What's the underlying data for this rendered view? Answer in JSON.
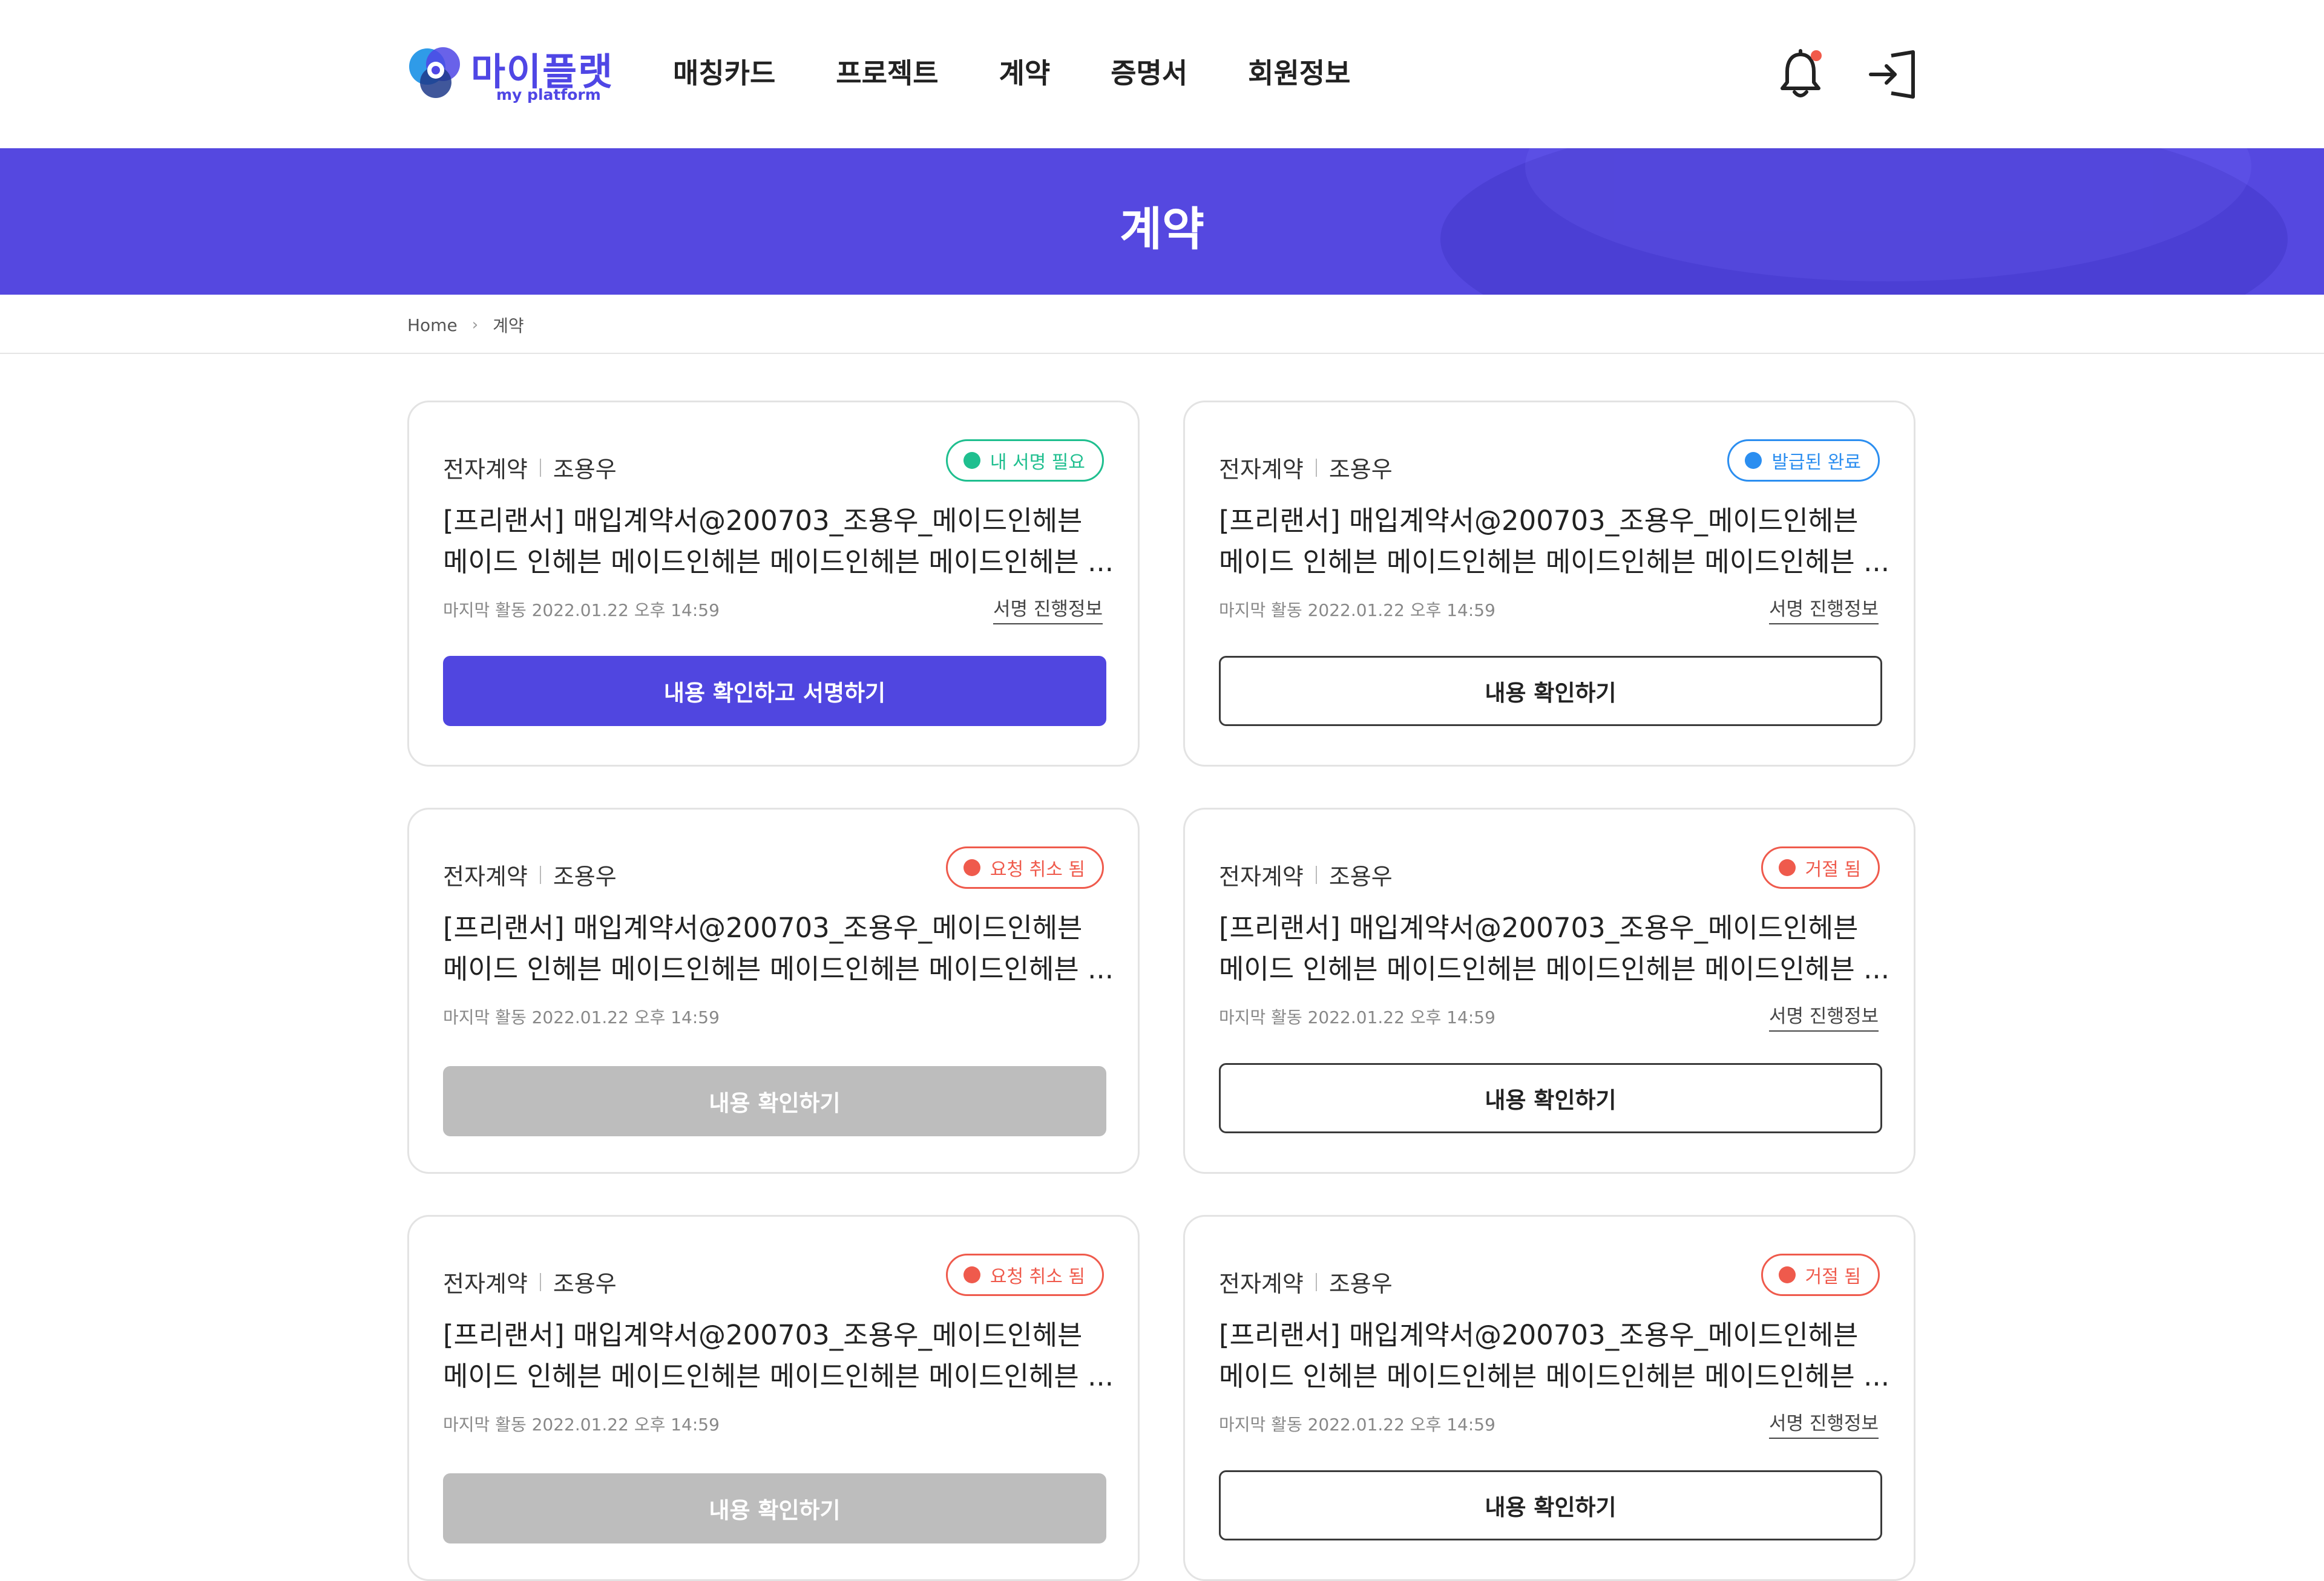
{
  "brand": {
    "name": "마이플랫",
    "sub": "my platform",
    "color": "#4f46e5"
  },
  "nav": {
    "items": [
      {
        "label": "매칭카드"
      },
      {
        "label": "프로젝트"
      },
      {
        "label": "계약"
      },
      {
        "label": "증명서"
      },
      {
        "label": "회원정보"
      }
    ],
    "bell_icon": "bell-icon",
    "logout_icon": "logout-icon",
    "notification_dot_color": "#f15a4a"
  },
  "banner": {
    "title": "계약",
    "color": "#5548e0"
  },
  "breadcrumb": {
    "home": "Home",
    "current": "계약"
  },
  "cards": [
    {
      "type": "전자계약",
      "name": "조용우",
      "status": "내 서명 필요",
      "status_color": "#1fbf8f",
      "title": "[프리랜서] 매입계약서@200703_조용우_메이드인헤븐 메이드 인헤븐 메이드인헤븐 메이드인헤븐 메이드인헤븐 ...",
      "meta": "마지막 활동 2022.01.22 오후 14:59",
      "link": "서명 진행정보",
      "button": "내용 확인하고 서명하기",
      "button_style": "primary"
    },
    {
      "type": "전자계약",
      "name": "조용우",
      "status": "발급된 완료",
      "status_color": "#2b8ef0",
      "title": "[프리랜서] 매입계약서@200703_조용우_메이드인헤븐 메이드 인헤븐 메이드인헤븐 메이드인헤븐 메이드인헤븐 ...",
      "meta": "마지막 활동 2022.01.22 오후 14:59",
      "link": "서명 진행정보",
      "button": "내용 확인하기",
      "button_style": "outline"
    },
    {
      "type": "전자계약",
      "name": "조용우",
      "status": "요청 취소 됨",
      "status_color": "#ef5a4c",
      "title": "[프리랜서] 매입계약서@200703_조용우_메이드인헤븐 메이드 인헤븐 메이드인헤븐 메이드인헤븐 메이드인헤븐 ...",
      "meta": "마지막 활동 2022.01.22 오후 14:59",
      "link": "",
      "button": "내용 확인하기",
      "button_style": "disabled"
    },
    {
      "type": "전자계약",
      "name": "조용우",
      "status": "거절 됨",
      "status_color": "#ef5a4c",
      "title": "[프리랜서] 매입계약서@200703_조용우_메이드인헤븐 메이드 인헤븐 메이드인헤븐 메이드인헤븐 메이드인헤븐 ...",
      "meta": "마지막 활동 2022.01.22 오후 14:59",
      "link": "서명 진행정보",
      "button": "내용 확인하기",
      "button_style": "outline"
    },
    {
      "type": "전자계약",
      "name": "조용우",
      "status": "요청 취소 됨",
      "status_color": "#ef5a4c",
      "title": "[프리랜서] 매입계약서@200703_조용우_메이드인헤븐 메이드 인헤븐 메이드인헤븐 메이드인헤븐 메이드인헤븐 ...",
      "meta": "마지막 활동 2022.01.22 오후 14:59",
      "link": "",
      "button": "내용 확인하기",
      "button_style": "disabled"
    },
    {
      "type": "전자계약",
      "name": "조용우",
      "status": "거절 됨",
      "status_color": "#ef5a4c",
      "title": "[프리랜서] 매입계약서@200703_조용우_메이드인헤븐 메이드 인헤븐 메이드인헤븐 메이드인헤븐 메이드인헤븐 ...",
      "meta": "마지막 활동 2022.01.22 오후 14:59",
      "link": "서명 진행정보",
      "button": "내용 확인하기",
      "button_style": "outline"
    }
  ]
}
